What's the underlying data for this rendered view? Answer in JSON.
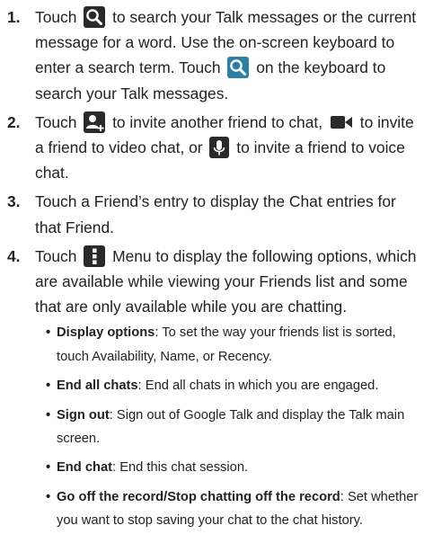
{
  "steps": [
    {
      "num": "1.",
      "text1": "Touch",
      "text2": "to search your Talk messages or the current message for a word. Use the on-screen keyboard to enter a search term. Touch",
      "text3": "on the keyboard to search your Talk messages.",
      "icon1": "search-icon",
      "icon2": "keyboard-search-icon"
    },
    {
      "num": "2.",
      "text1": "Touch",
      "text2": "to invite another friend to chat,",
      "text3": "to invite a friend to video chat, or",
      "text4": "to invite a friend to voice chat.",
      "icon1": "add-friend-icon",
      "icon2": "video-camera-icon",
      "icon3": "microphone-icon"
    },
    {
      "num": "3.",
      "text": "Touch a Friend’s entry to display the Chat entries for that Friend."
    },
    {
      "num": "4.",
      "text1": "Touch",
      "text2": "Menu to display the following options, which are available while viewing your Friends list and some that are only available while you are chatting.",
      "icon1": "menu-icon"
    }
  ],
  "options": [
    {
      "title": "Display options",
      "desc": ": To set the way your friends list is sorted, touch Availability, Name, or Recency."
    },
    {
      "title": "End all chats",
      "desc": ": End all chats in which you are engaged."
    },
    {
      "title": "Sign out",
      "desc": ": Sign out of Google Talk and display the Talk main screen."
    },
    {
      "title": "End chat",
      "desc": ": End this chat session."
    },
    {
      "title": "Go off the record/Stop chatting off the record",
      "desc": ": Set whether you want to stop saving your chat to the chat history."
    }
  ],
  "colors": {
    "icon_dark": "#2a2a2a",
    "icon_keyboard": "#2d7fa4"
  }
}
